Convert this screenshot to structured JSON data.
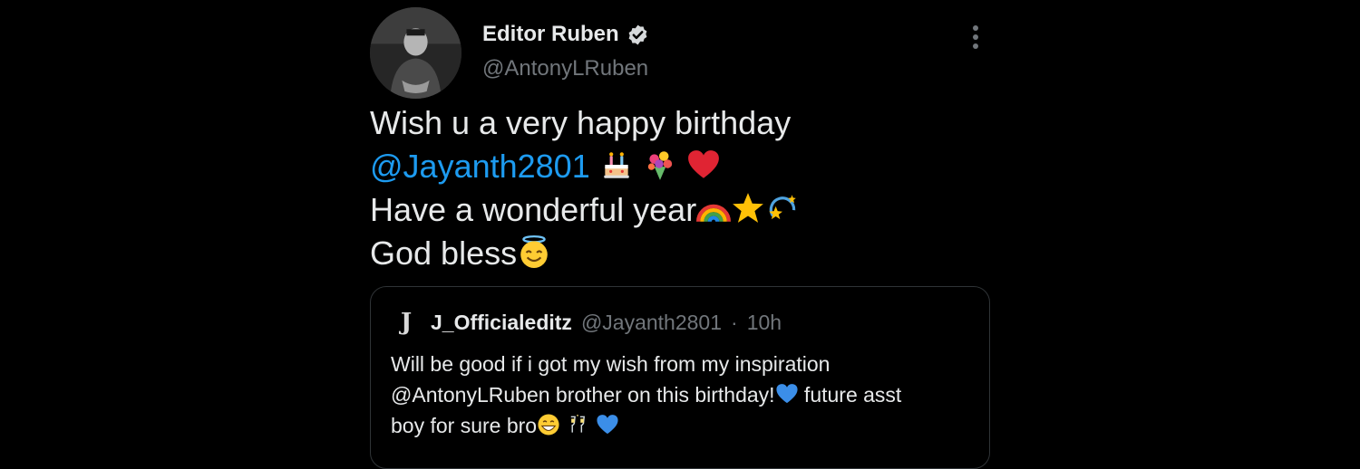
{
  "author": {
    "display_name": "Editor Ruben",
    "handle": "@AntonyLRuben",
    "verified": true
  },
  "tweet": {
    "line1": "Wish u a very happy birthday",
    "mention": "@Jayanth2801",
    "line3": "Have a wonderful year",
    "line4": "God bless",
    "emojis_line2": [
      "birthday-cake-emoji",
      "bouquet-emoji",
      "red-heart-emoji"
    ],
    "emojis_line3": [
      "rainbow-emoji",
      "star-emoji",
      "dizzy-emoji"
    ],
    "emojis_line4": [
      "smiling-halo-emoji"
    ]
  },
  "quoted": {
    "logo": "J",
    "display_name": "J_Officialeditz",
    "handle": "@Jayanth2801",
    "separator": "·",
    "time": "10h",
    "line1": "Will be good if i got my wish from my inspiration",
    "line2": "@AntonyLRuben brother on this birthday!",
    "line2_tail": " future asst",
    "line3": "boy for sure bro",
    "emojis": [
      "blue-heart-emoji",
      "grinning-emoji",
      "champagne-glasses-emoji",
      "blue-heart-emoji"
    ]
  },
  "colors": {
    "background": "#000000",
    "text": "#e7e9ea",
    "secondary": "#71767b",
    "link": "#1d9bf0",
    "border": "#2f3336"
  }
}
